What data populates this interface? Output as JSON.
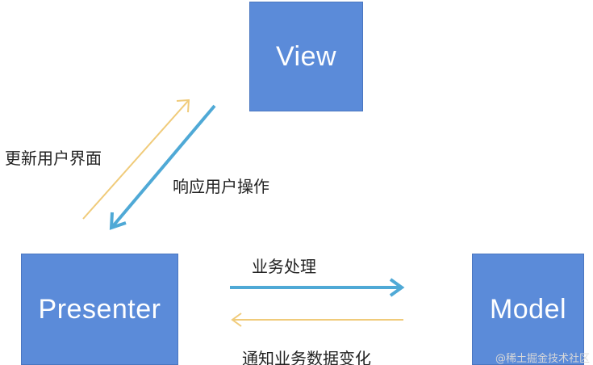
{
  "nodes": {
    "view": "View",
    "presenter": "Presenter",
    "model": "Model"
  },
  "edges": {
    "update_ui": "更新用户界面",
    "respond_user_action": "响应用户操作",
    "business_process": "业务处理",
    "notify_data_change": "通知业务数据变化"
  },
  "watermark": "@稀土掘金技术社区",
  "colors": {
    "box_fill": "#5b8bd9",
    "arrow_blue": "#4fa9d6",
    "arrow_yellow": "#f0cb7a"
  }
}
